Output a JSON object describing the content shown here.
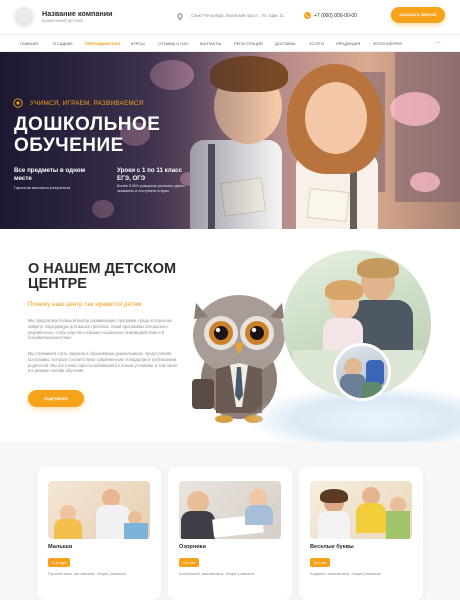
{
  "header": {
    "company_name": "Название компании",
    "company_sub": "дошкольный детский",
    "address": "Санкт-Петербург, Лиговский просп., 70, офис 11",
    "phone": "+7 (000) 000-00-00",
    "call_button": "ЗАКАЗАТЬ ЗВОНОК"
  },
  "nav": {
    "items": [
      "ГЛАВНАЯ",
      "О САДИКЕ",
      "ПРЕПОДАВАТЕЛИ",
      "КУРСЫ",
      "ОТЗЫВЫ О НАС",
      "КОНТАКТЫ",
      "РЕГИСТРАЦИЯ",
      "ДОСТАВКА",
      "УСЛУГИ",
      "ПРОДУКЦИЯ",
      "ФОТОГАЛЕРЕЯ"
    ],
    "active_index": 2,
    "more": "..."
  },
  "hero": {
    "tagline": "УЧИМСЯ, ИГРАЕМ, РАЗВИВАЕМСЯ",
    "title_line1": "ДОШКОЛЬНОЕ",
    "title_line2": "ОБУЧЕНИЕ",
    "feature1_title": "Все предметы в одном месте",
    "feature1_text": "Гарантия высокого результата",
    "feature2_title": "Уроки с 1 по 11 класс ЕГЭ, ОГЭ",
    "feature2_text": "Более 5 000 учащихся успешно сдали экзамены и поступили в вузы"
  },
  "about": {
    "title_line1": "О НАШЕМ ДЕТСКОМ",
    "title_line2": "ЦЕНТРЕ",
    "subtitle": "Почему наш центр так нравится детям",
    "paragraph1": "Мы предлагаем большой выбор развивающих программ, среди которых вы найдете подходящую для вашего ребенка. Наши программы специально разработаны, чтобы упрочить навыки социального взаимодействия и в познавательном плане",
    "paragraph2": "Мы стремимся стать лидером в образовании дошкольников, предоставляя программы, которые соответствуют современным стандартам и требованиям родителей. Мы постоянно приспосабливаемся к новым условиям, в том числе и в режиме онлайн-обучения.",
    "button": "ПОДРОБНЕЕ"
  },
  "courses": [
    {
      "title": "Малыши",
      "age": "2-4 года",
      "desc": "Русский язык, английский, общее развитие"
    },
    {
      "title": "Озорники",
      "age": "4-5 лет",
      "desc": "Английский, математика, общее развитие"
    },
    {
      "title": "Веселые буквы",
      "age": "5-6 лет",
      "desc": "Алфавит, математика, общее развитие"
    }
  ],
  "colors": {
    "accent": "#f6a21a",
    "text_dark": "#2b2b2b",
    "text_muted": "#8d8d8d",
    "section_bg": "#f7f7f8"
  }
}
